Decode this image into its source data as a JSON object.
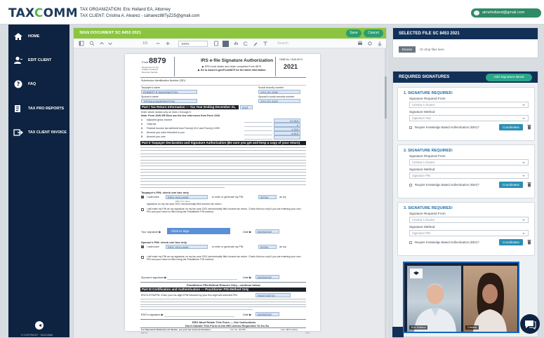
{
  "brand": {
    "logo_a": "TAX",
    "logo_b": "C",
    "logo_c": "OMM"
  },
  "header": {
    "organization": "TAX ORGANIZATION: Eric Holland EA, Attorney",
    "client": "TAX CLIENT: Cristina A. Alvarez - cahanez88TyZ25@gmail.com",
    "user_email": "aimeholland@gmail.com"
  },
  "sidebar": {
    "items": [
      {
        "label": "HOME",
        "icon": "home-icon"
      },
      {
        "label": "EDIT CLIENT",
        "icon": "user-icon"
      },
      {
        "label": "FAQ",
        "icon": "question-icon"
      },
      {
        "label": "TAX PRO REPORTS",
        "icon": "reports-icon"
      },
      {
        "label": "TAX CLIENT INVOICE",
        "icon": "invoice-icon"
      }
    ],
    "copyright": "© COPYRIGHT · TAXCOMM"
  },
  "document": {
    "title": "SIGN DOCUMENT SC 8453 2021",
    "save_label": "Save",
    "cancel_label": "Cancel",
    "page_indicator": "1/3",
    "zoom": "100%",
    "search_placeholder": "Search",
    "pdf": {
      "form_label": "Form",
      "form_number": "8879",
      "form_title": "IRS e-file Signature Authorization",
      "omb": "OMB No. 1545-0074",
      "year": "2021",
      "line_do_not_send": "▶ ERO must obtain and retain completed Form 8879.",
      "line_goto": "▶ Go to www.irs.gov/Form8879 for the latest information.",
      "dept": "Department of the Treasury Internal Revenue Service",
      "submission": "Submission Identification Number (SID)",
      "taxpayer_name_label": "Taxpayer's name",
      "taxpayer_name": "ROBERT R WASHINGTON",
      "ssn_label": "Social security number",
      "ssn": "XXX-XX-1940",
      "spouse_name_label": "Spouse's name",
      "spouse_name": "TESSA A WASHINGTON",
      "spouse_ssn_label": "Spouse's social security number",
      "spouse_ssn": "XXX-XX-1922",
      "part1_title": "Part I   Tax Return Information — Tax Year Ending December 31,",
      "part1_year": "2021",
      "part1_note": "Enter whole dollars only on lines 1 through 5.",
      "part1_sub": "Note: Form 1040-SR filers use the line references from Form 1040.",
      "lines": [
        {
          "n": "1",
          "label": "Adjusted gross income",
          "value": "47,818"
        },
        {
          "n": "2",
          "label": "Total tax",
          "value": "0"
        },
        {
          "n": "3",
          "label": "Federal income tax withheld from Form(s) W-2 and Form(s) 1099",
          "value": "1,204"
        },
        {
          "n": "4",
          "label": "Amount you want refunded to you",
          "value": "4,819"
        },
        {
          "n": "5",
          "label": "Amount you owe",
          "value": ""
        }
      ],
      "part2_title": "Part II   Taxpayer Declaration and Signature Authorization (Be sure you get and keep a copy of your return)",
      "taxpayer_pin_head": "Taxpayer's PIN: check one box only",
      "auth_label": "I authorize",
      "ero_firm": "ERIC HOLLAND",
      "ero_firm_cap": "ERO firm name",
      "pin_cap": "to enter or generate my PIN",
      "pin_value": "93754",
      "as_my": "as my",
      "pin_sig_line": "signature on my tax year 2021 electronically filed income tax return.",
      "will_enter": "I will enter my PIN as my signature on my tax year 2021 electronically filed income tax return. Check this box only if you are entering your own PIN and your return is filed using the Practitioner PIN method.",
      "your_signature": "Your signature ▶",
      "click_to_sign": "Click to Sign",
      "date_label": "Date ▶",
      "date_value": "05/20/2022",
      "spouse_pin_head": "Spouse's PIN: check one box only",
      "ero_firm2": "ERIC HOLLAND",
      "spouse_signature": "Spouse's signature ▶",
      "date_value2": "05/20/2022",
      "practitioner_note": "Practitioner PIN Method Returns Only—continue below",
      "part3_title": "Part III   Certification and Authentication — Practitioner PIN Method Only",
      "efin_label": "ERO's EFIN/PIN. Enter your six-digit EFIN followed by your five-digit self-selected PIN.",
      "efin_value": "95447133710",
      "ero_sig_label": "ERO's signature ▶",
      "ero_date": "05/20/2022",
      "retain_title": "ERO Must Retain This Form — See Instructions",
      "retain_sub": "Don't Submit This Form to the IRS Unless Requested To Do So",
      "footer_left": "For Paperwork Reduction Act Notice, see your tax return instructions.",
      "footer_cat": "Cat. No. 32778X",
      "footer_right": "Form 8879 (2021)"
    },
    "page_footer_left": "8879",
    "page_footer_right": "1/3"
  },
  "selected_file": {
    "title": "SELECTED FILE SC 8453 2021",
    "tag": "Browse",
    "drop_text": "Or drop files here"
  },
  "signatures": {
    "title": "REQUIRED SIGNATURES",
    "add_label": "Add Signature Block",
    "cards": [
      {
        "title": "1. SIGNATURE REQUIRED:",
        "from_label": "Signature Required From",
        "from_value": "Cristina A Alvarez",
        "method_label": "Signature Method",
        "method_value": "Signature Pad",
        "kba": "Require Knowledge Based Authentication (KBA)?",
        "coord": "Coordinates"
      },
      {
        "title": "2. SIGNATURE REQUIRED:",
        "from_label": "Signature Required From",
        "from_value": "Cristina A Alvarez",
        "method_label": "Signature Method",
        "method_value": "Signature PIN",
        "kba": "Require Knowledge Based Authentication (KBA)?",
        "coord": "Coordinates"
      },
      {
        "title": "3. SIGNATURE REQUIRED:",
        "from_label": "Signature Required From",
        "from_value": "Cristina A Alvarez",
        "method_label": "Signature Method",
        "method_value": "Signature PIN",
        "kba": "Require Knowledge Based Authentication (KBA)?",
        "coord": "Coordinates"
      }
    ]
  },
  "video": {
    "left_name": "Eric Holland",
    "right_name": "Cristina"
  },
  "colors": {
    "navy": "#0e2341",
    "green": "#8bc540",
    "teal": "#2a9d6e",
    "blue": "#1766c0"
  }
}
